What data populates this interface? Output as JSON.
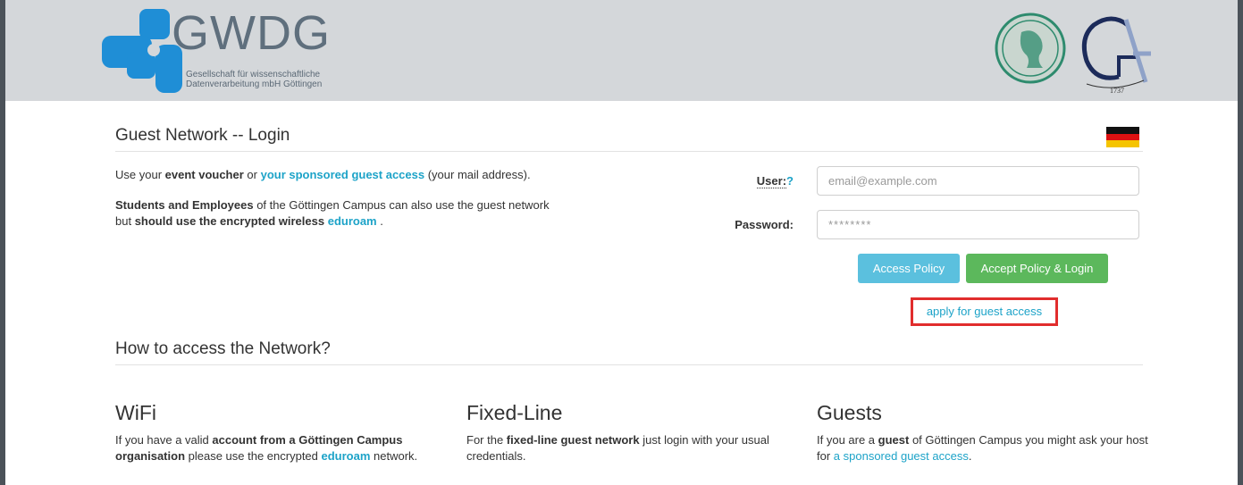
{
  "header": {
    "brand": "GWDG",
    "subtitle_line1": "Gesellschaft für wissenschaftliche",
    "subtitle_line2": "Datenverarbeitung mbH Göttingen",
    "colors": {
      "logo_blue": "#1f8ed6",
      "header_bg": "#d4d7da"
    },
    "goettingen_logo": {
      "monogram": "GA",
      "year": "1737"
    }
  },
  "login": {
    "title": "Guest Network -- Login",
    "language_flag": "german-flag",
    "intro": {
      "use_your": "Use your ",
      "event_voucher": "event voucher",
      "or": " or ",
      "sponsored_link": "your sponsored guest access",
      "mail_note": " (your mail address)."
    },
    "students": {
      "bold1": "Students and Employees",
      "text1": " of the Göttingen Campus can also use the guest network",
      "text2": "but ",
      "bold2": "should use the encrypted wireless",
      "link": "eduroam",
      "end": " ."
    },
    "user_label": "User:",
    "user_help": "?",
    "user_placeholder": "email@example.com",
    "password_label": "Password:",
    "password_placeholder": "********",
    "access_policy_button": "Access Policy",
    "accept_login_button": "Accept Policy & Login",
    "apply_link": "apply for guest access"
  },
  "howto": {
    "title": "How to access the Network?",
    "wifi": {
      "title": "WiFi",
      "t1": "If you have a valid ",
      "b1": "account from a Göttingen Campus organisation",
      "t2": " please use the encrypted ",
      "link": "eduroam",
      "t3": " network."
    },
    "fixed": {
      "title": "Fixed-Line",
      "t1": "For the ",
      "b1": "fixed-line guest network",
      "t2": " just login with your usual credentials."
    },
    "guests": {
      "title": "Guests",
      "t1": "If you are a ",
      "b1": "guest",
      "t2": " of Göttingen Campus you might ask your host for ",
      "link": "a sponsored guest access",
      "t3": "."
    }
  }
}
